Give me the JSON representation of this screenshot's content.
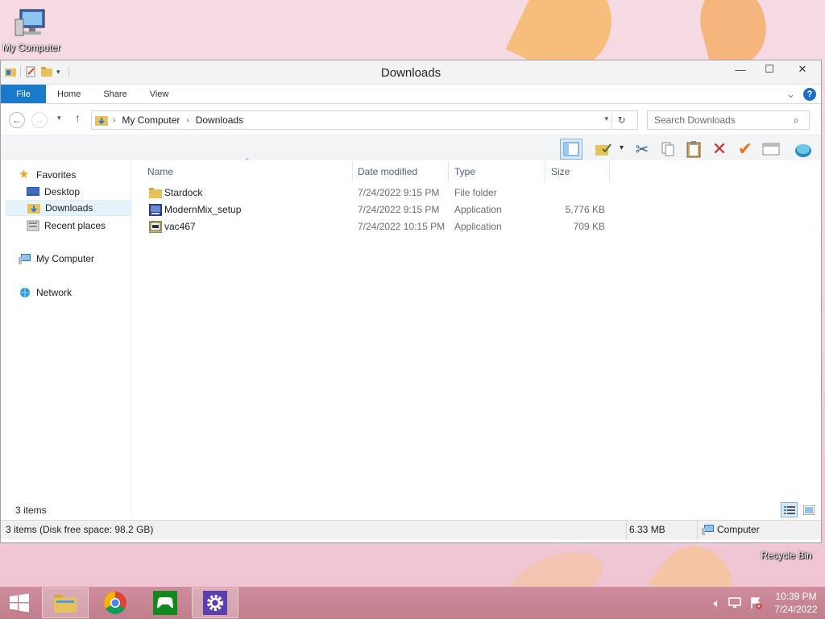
{
  "desktop": {
    "icons": [
      {
        "label": "My Computer"
      },
      {
        "label": "Recycle Bin"
      }
    ]
  },
  "window": {
    "title": "Downloads",
    "controls": {
      "minimize": "—",
      "maximize": "☐",
      "close": "✕"
    },
    "ribbon_tabs": [
      "File",
      "Home",
      "Share",
      "View"
    ],
    "ribbon_expand_glyph": "⌄",
    "help_glyph": "?",
    "address": {
      "segments": [
        "My Computer",
        "Downloads"
      ],
      "separator": "›"
    },
    "search_placeholder": "Search Downloads",
    "nav_pane": {
      "favorites_label": "Favorites",
      "favorites": [
        "Desktop",
        "Downloads",
        "Recent places"
      ],
      "my_computer": "My Computer",
      "network": "Network",
      "selected": "Downloads"
    },
    "columns": [
      "Name",
      "Date modified",
      "Type",
      "Size"
    ],
    "files": [
      {
        "name": "Stardock",
        "date": "7/24/2022 9:15 PM",
        "type": "File folder",
        "size": "",
        "icon": "folder-icon"
      },
      {
        "name": "ModernMix_setup",
        "date": "7/24/2022 9:15 PM",
        "type": "Application",
        "size": "5,776 KB",
        "icon": "installer-icon"
      },
      {
        "name": "vac467",
        "date": "7/24/2022 10:15 PM",
        "type": "Application",
        "size": "709 KB",
        "icon": "application-icon"
      }
    ],
    "item_count": "3 items",
    "status": {
      "left": "3 items (Disk free space: 98.2 GB)",
      "size": "6.33 MB",
      "location": "Computer"
    }
  },
  "taskbar": {
    "time": "10:39 PM",
    "date": "7/24/2022"
  },
  "colors": {
    "accent": "#1979ca",
    "selection": "#e5f3fb",
    "taskbar": "#c98896"
  }
}
